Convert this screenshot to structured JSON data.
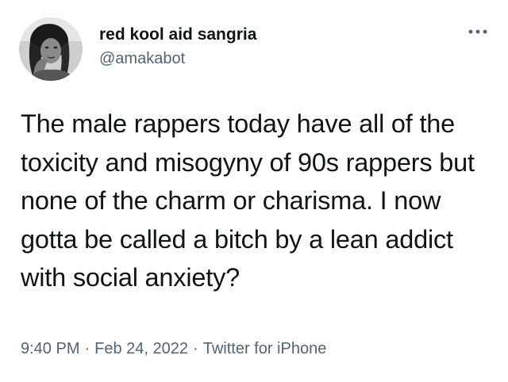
{
  "user": {
    "display_name": "red kool aid sangria",
    "handle": "@amakabot"
  },
  "more_icon": "more-horizontal-icon",
  "tweet": {
    "text": "The male rappers today have all of the toxicity and misogyny of 90s rappers but none of the charm or charisma. I now gotta be called a bitch by a lean addict with social anxiety?"
  },
  "meta": {
    "time": "9:40 PM",
    "separator": "·",
    "date": "Feb 24, 2022",
    "source": "Twitter for iPhone"
  },
  "colors": {
    "text": "#0f1419",
    "secondary": "#536471",
    "background": "#ffffff"
  }
}
